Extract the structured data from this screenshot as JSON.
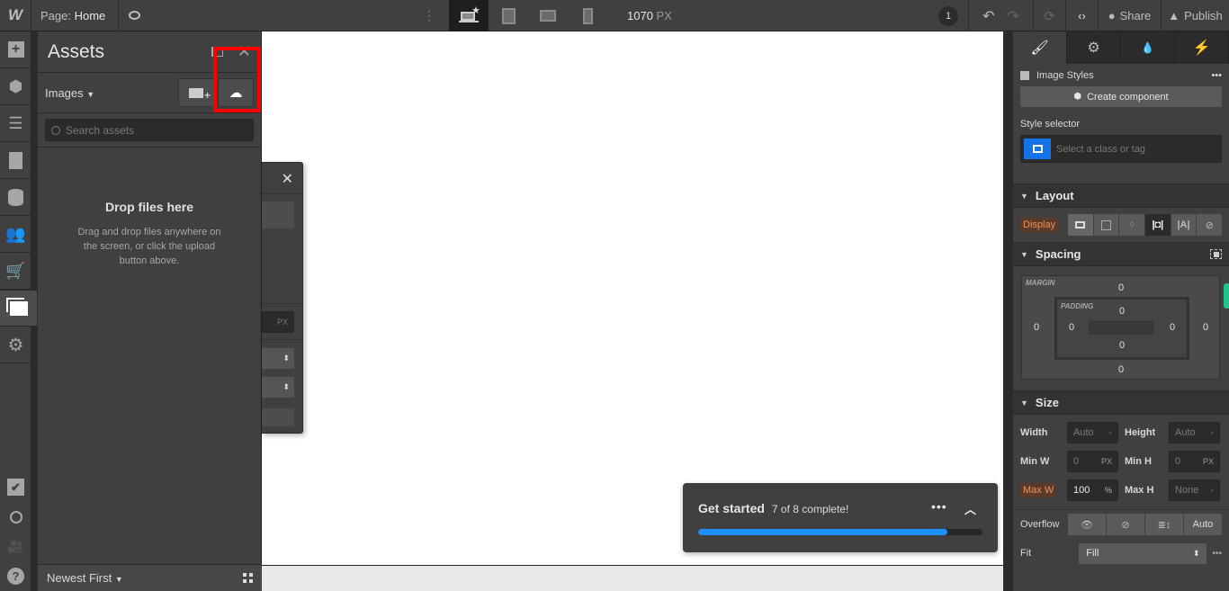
{
  "topbar": {
    "logo": "W",
    "page_prefix": "Page:",
    "page_name": "Home",
    "breakpoint_width": "1070",
    "breakpoint_unit": "PX",
    "notification_count": "1",
    "share_label": "Share",
    "publish_label": "Publish"
  },
  "left_rail": {
    "items": [
      "add-panel",
      "components",
      "navigator",
      "pages",
      "cms",
      "users",
      "ecommerce",
      "assets",
      "settings"
    ],
    "active": "assets",
    "bottom_items": [
      "audit",
      "search",
      "video-tutorials",
      "help"
    ]
  },
  "assets_panel": {
    "title": "Assets",
    "filter_label": "Images",
    "search_placeholder": "Search assets",
    "drop_title": "Drop files here",
    "drop_text": "Drag and drop files anywhere on the screen, or click the upload button above.",
    "sort_label": "Newest First"
  },
  "floating_popup": {
    "unit_label": "PX"
  },
  "get_started": {
    "title": "Get started",
    "status": "7 of 8 complete!",
    "progress_fraction": 0.875,
    "accent": "#1e90ff"
  },
  "style_panel": {
    "element_label": "Image Styles",
    "create_component_label": "Create component",
    "style_selector_label": "Style selector",
    "selector_placeholder": "Select a class or tag",
    "layout": {
      "title": "Layout",
      "display_label": "Display",
      "display_options": [
        "block",
        "flex",
        "grid",
        "inline-block",
        "inline",
        "none"
      ],
      "display_active": "inline-block"
    },
    "spacing": {
      "title": "Spacing",
      "margin_label": "MARGIN",
      "padding_label": "PADDING",
      "margin": {
        "top": "0",
        "right": "0",
        "bottom": "0",
        "left": "0"
      },
      "padding": {
        "top": "0",
        "right": "0",
        "bottom": "0",
        "left": "0"
      }
    },
    "size": {
      "title": "Size",
      "width_label": "Width",
      "width_value": "Auto",
      "width_unit": "-",
      "height_label": "Height",
      "height_value": "Auto",
      "height_unit": "-",
      "min_w_label": "Min W",
      "min_w_value": "0",
      "min_w_unit": "PX",
      "min_h_label": "Min H",
      "min_h_value": "0",
      "min_h_unit": "PX",
      "max_w_label": "Max W",
      "max_w_value": "100",
      "max_w_unit": "%",
      "max_h_label": "Max H",
      "max_h_value": "None",
      "max_h_unit": "-",
      "overflow_label": "Overflow",
      "overflow_auto": "Auto",
      "fit_label": "Fit",
      "fit_value": "Fill"
    }
  }
}
